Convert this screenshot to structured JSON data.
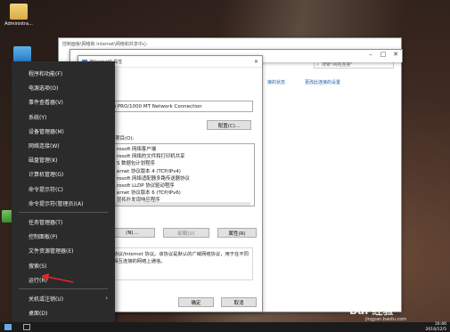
{
  "desktop": {
    "icons": [
      {
        "label": "Administra...",
        "name": "user-folder-icon"
      }
    ]
  },
  "back_window": {
    "title": "控制面板\\网络和 Internet\\网络和共享中心",
    "search_placeholder": "搜索\"网络连接\"",
    "commands": [
      "更改此连接的设置"
    ],
    "status_link": "接的状态"
  },
  "dialog": {
    "title": "Ethernet0 属性",
    "adapter_name": "(R) PRO/1000 MT Network Connection",
    "configure_button": "配置(C)...",
    "items_label": "下列项目(O):",
    "items": [
      {
        "label": "rosoft 网络客户端",
        "checked": true
      },
      {
        "label": "rosoft 网络的文件和打印机共享",
        "checked": true
      },
      {
        "label": "S 数据包计划程序",
        "checked": true
      },
      {
        "label": "ernet 协议版本 4 (TCP/IPv4)",
        "checked": true
      },
      {
        "label": "rosoft 网络适配器多路传送器协议",
        "checked": false
      },
      {
        "label": "rosoft LLDP 协议驱动程序",
        "checked": true
      },
      {
        "label": "ernet 协议版本 6 (TCP/IPv6)",
        "checked": true
      },
      {
        "label": "层拓扑发现响应程序",
        "checked": true
      }
    ],
    "install_button": "(N)...",
    "uninstall_button": "卸载(U)",
    "properties_button": "属性(R)",
    "description": "制协议/Internet 协议。该协议是默认的广域网络协议，用于在不同的相互连接的网络上通信。",
    "ok_button": "确定",
    "cancel_button": "取消"
  },
  "menu": {
    "groups": [
      [
        "程序和功能(F)",
        "电源选项(O)",
        "事件查看器(V)",
        "系统(Y)",
        "设备管理器(M)",
        "网络连接(W)",
        "磁盘管理(K)",
        "计算机管理(G)",
        "命令提示符(C)",
        "命令提示符(管理员)(A)"
      ],
      [
        "任务管理器(T)",
        "控制面板(P)",
        "文件资源管理器(E)",
        "搜索(S)",
        "运行(R)"
      ],
      [
        "关机或注销(U)",
        "桌面(D)"
      ]
    ],
    "submenu_arrow": "›"
  },
  "taskbar": {
    "time": "16:46",
    "date": "2016/12/5"
  },
  "watermark": {
    "text": "Bai 经验",
    "url": "jingyan.baidu.com"
  },
  "colors": {
    "menu_bg": "#2b2b2b",
    "arrow": "#e8262a"
  }
}
